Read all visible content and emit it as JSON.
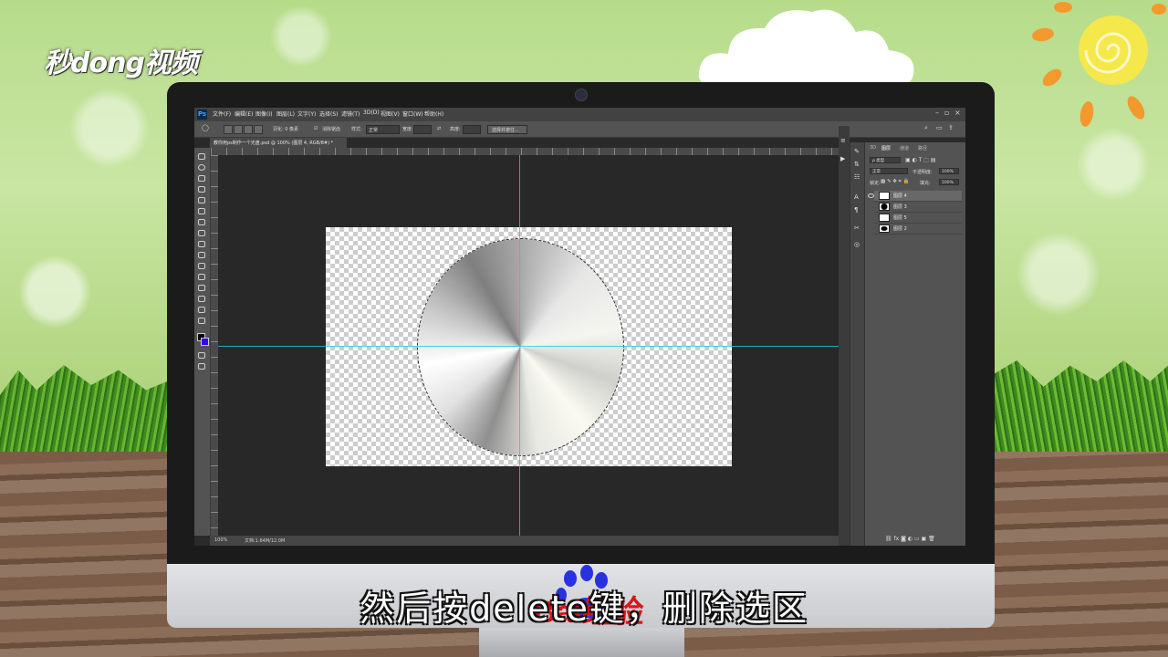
{
  "brand": {
    "text": "秒dong视频"
  },
  "subtitle": {
    "text": "然后按delete键，删除选区"
  },
  "watermark": {
    "text": "Bai经验"
  },
  "photoshop": {
    "app_logo": "Ps",
    "menu": [
      "文件(F)",
      "编辑(E)",
      "图像(I)",
      "图层(L)",
      "文字(Y)",
      "选择(S)",
      "滤镜(T)",
      "3D(D)",
      "视图(V)",
      "窗口(W)",
      "帮助(H)"
    ],
    "options": {
      "feather": "羽化: 0 像素",
      "antialias": "消除锯齿",
      "style_label": "样式:",
      "style_value": "正常",
      "width_label": "宽度:",
      "height_label": "高度:",
      "select_mask": "选择并遮住..."
    },
    "document_tab": "教你用ps制作一个光盘.psd @ 100% (图层 4, RGB/8#) *",
    "status": {
      "zoom": "100%",
      "doc": "文档:1.64M/12.0M"
    },
    "layers_panel": {
      "tabs": [
        "3D",
        "图层",
        "通道",
        "路径"
      ],
      "filter_kind": "ρ 类型",
      "blend_mode": "正常",
      "opacity_label": "不透明度:",
      "opacity_value": "100%",
      "lock_label": "锁定:",
      "fill_label": "填充:",
      "fill_value": "100%",
      "layers": [
        {
          "name": "图层 4",
          "active": true
        },
        {
          "name": "图层 3",
          "active": false
        },
        {
          "name": "图层 5",
          "active": false
        },
        {
          "name": "图层 2",
          "active": false
        }
      ]
    },
    "colors": {
      "foreground": "#000000",
      "background": "#3300ff",
      "guide": "#28c8d0"
    }
  }
}
